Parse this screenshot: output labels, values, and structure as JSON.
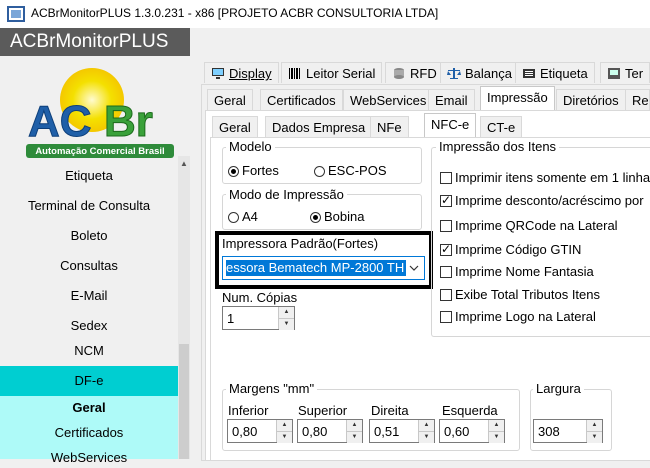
{
  "window": {
    "title": "ACBrMonitorPLUS 1.3.0.231 - x86  [PROJETO ACBR CONSULTORIA LTDA]",
    "app_name": "ACBrMonitorPLUS"
  },
  "logo": {
    "text_a": "AC",
    "text_b": "Br",
    "tagline": "Automação Comercial Brasil"
  },
  "sidebar": {
    "items": [
      {
        "label": "Etiqueta"
      },
      {
        "label": "Terminal de Consulta"
      },
      {
        "label": "Boleto"
      },
      {
        "label": "Consultas"
      },
      {
        "label": "E-Mail"
      },
      {
        "label": "Sedex"
      },
      {
        "label": "NCM"
      },
      {
        "label": "DF-e"
      },
      {
        "label": "Geral"
      },
      {
        "label": "Certificados"
      },
      {
        "label": "WebServices"
      }
    ]
  },
  "top_tabs": [
    {
      "label": "Display",
      "icon": "display-icon"
    },
    {
      "label": "Leitor Serial",
      "icon": "barcode-icon"
    },
    {
      "label": "RFD",
      "icon": "database-icon"
    },
    {
      "label": "Balança",
      "icon": "scale-icon"
    },
    {
      "label": "Etiqueta",
      "icon": "label-printer-icon"
    },
    {
      "label": "Ter",
      "icon": "terminal-icon"
    }
  ],
  "second_tabs": [
    "Geral",
    "Certificados",
    "WebServices",
    "Email",
    "Impressão",
    "Diretórios",
    "Res"
  ],
  "third_tabs": [
    "Geral",
    "Dados Empresa",
    "NFe",
    "NFC-e",
    "CT-e"
  ],
  "modelo": {
    "legend": "Modelo",
    "options": [
      "Fortes",
      "ESC-POS"
    ],
    "selected": "Fortes"
  },
  "modo_impressao": {
    "legend": "Modo de Impressão",
    "options": [
      "A4",
      "Bobina"
    ],
    "selected": "Bobina"
  },
  "impressora": {
    "label": "Impressora Padrão(Fortes)",
    "value": "essora Bematech MP-2800 TH"
  },
  "num_copias": {
    "label": "Num. Cópias",
    "value": "1"
  },
  "impressao_itens": {
    "legend": "Impressão dos Itens",
    "checks": [
      {
        "label": "Imprimir itens somente em 1 linha",
        "checked": false
      },
      {
        "label": "Imprime desconto/acréscimo por",
        "checked": true
      },
      {
        "label": "Imprime QRCode na Lateral",
        "checked": false
      },
      {
        "label": "Imprime Código GTIN",
        "checked": true
      },
      {
        "label": "Imprime Nome Fantasia",
        "checked": false
      },
      {
        "label": "Exibe Total Tributos Itens",
        "checked": false
      },
      {
        "label": "Imprime Logo na Lateral",
        "checked": false
      }
    ]
  },
  "margens": {
    "legend": "Margens \"mm\"",
    "fields": [
      {
        "label": "Inferior",
        "value": "0,80"
      },
      {
        "label": "Superior",
        "value": "0,80"
      },
      {
        "label": "Direita",
        "value": "0,51"
      },
      {
        "label": "Esquerda",
        "value": "0,60"
      }
    ]
  },
  "largura": {
    "label": "Largura",
    "value": "308"
  },
  "colors": {
    "sidebar_active": "#00ced1",
    "sidebar_sub": "#aefaf8",
    "selection": "#0078d7",
    "header": "#5b5b5b"
  }
}
